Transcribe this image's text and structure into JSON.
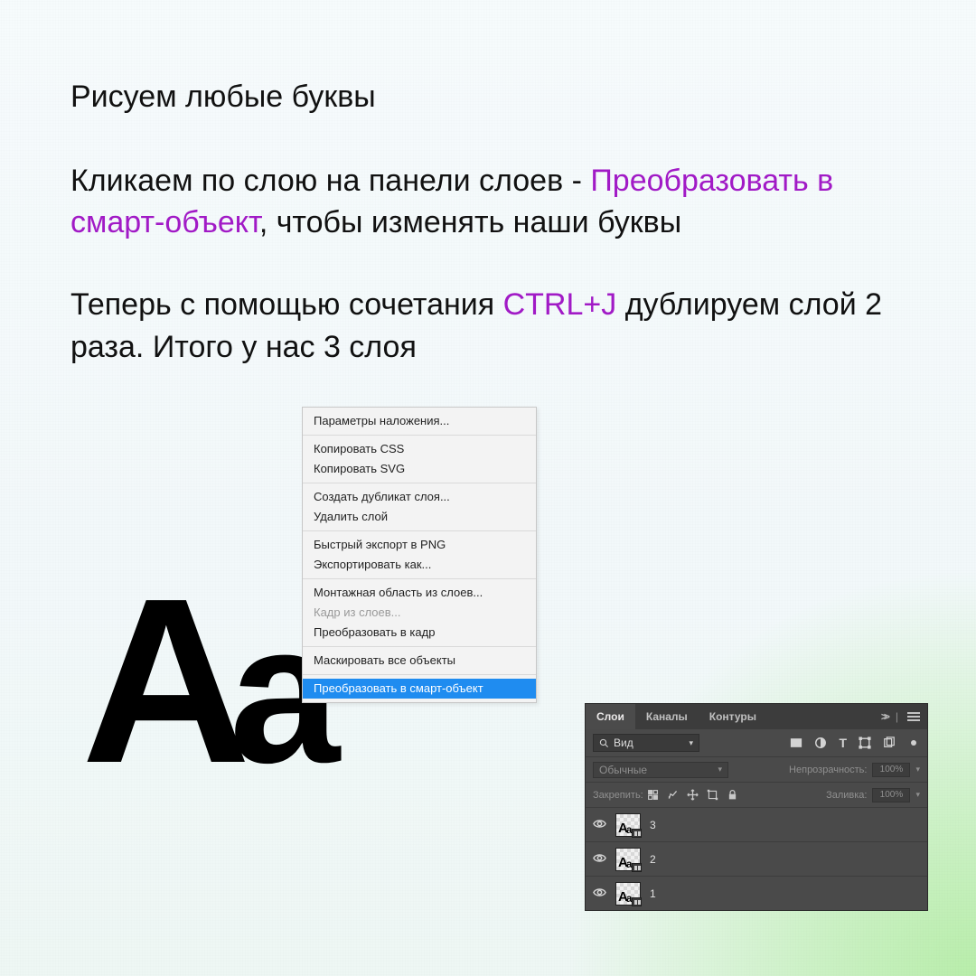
{
  "title": "Рисуем любые буквы",
  "p2_a": "Кликаем по слою на панели слоев - ",
  "p2_b": "Преобразовать в смарт-объект",
  "p2_c": ", чтобы изменять наши буквы",
  "p3_a": "Теперь с помощью сочетания ",
  "p3_b": "CTRL+J",
  "p3_c": " дублируем слой 2 раза. Итого у нас 3 слоя",
  "letters": {
    "cap": "А",
    "low": "а"
  },
  "context_menu": {
    "g1": [
      "Параметры наложения..."
    ],
    "g2": [
      "Копировать CSS",
      "Копировать SVG"
    ],
    "g3": [
      "Создать дубликат слоя...",
      "Удалить слой"
    ],
    "g4": [
      "Быстрый экспорт в PNG",
      "Экспортировать как..."
    ],
    "g5": [
      {
        "label": "Монтажная область из слоев..."
      },
      {
        "label": "Кадр из слоев...",
        "disabled": true
      },
      {
        "label": "Преобразовать в кадр"
      }
    ],
    "g6": [
      "Маскировать все объекты"
    ],
    "g7_selected": "Преобразовать в смарт-объект"
  },
  "layers_panel": {
    "tabs": {
      "active": "Слои",
      "t2": "Каналы",
      "t3": "Контуры"
    },
    "search": {
      "label": "Вид"
    },
    "blend": "Обычные",
    "opacity_label": "Непрозрачность:",
    "opacity_value": "100%",
    "lock_label": "Закрепить:",
    "fill_label": "Заливка:",
    "fill_value": "100%",
    "layers": [
      {
        "name": "3"
      },
      {
        "name": "2"
      },
      {
        "name": "1"
      }
    ]
  }
}
